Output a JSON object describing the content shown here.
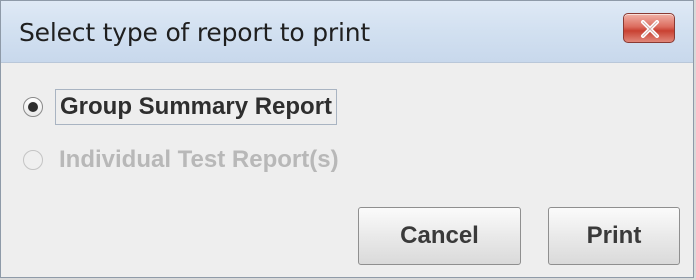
{
  "dialog": {
    "title": "Select type of report to print",
    "close_icon": "close-icon",
    "accent_colors": {
      "titlebar": "#d3e1f1",
      "close_button": "#c94132"
    }
  },
  "options": [
    {
      "label": "Group Summary Report",
      "selected": true,
      "enabled": true
    },
    {
      "label": "Individual Test Report(s)",
      "selected": false,
      "enabled": false
    }
  ],
  "buttons": {
    "cancel_label": "Cancel",
    "print_label": "Print"
  }
}
